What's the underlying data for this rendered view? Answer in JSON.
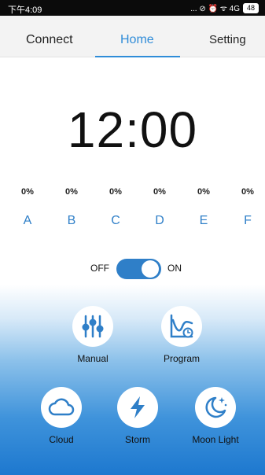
{
  "status_bar": {
    "time": "下午4:09",
    "icons": "... ⊘ ⏰ ᯤ 4G",
    "battery": "48"
  },
  "tabs": {
    "connect": "Connect",
    "home": "Home",
    "setting": "Setting",
    "active": "Home"
  },
  "clock": "12:00",
  "channels": [
    {
      "pct": "0%",
      "label": "A"
    },
    {
      "pct": "0%",
      "label": "B"
    },
    {
      "pct": "0%",
      "label": "C"
    },
    {
      "pct": "0%",
      "label": "D"
    },
    {
      "pct": "0%",
      "label": "E"
    },
    {
      "pct": "0%",
      "label": "F"
    }
  ],
  "power": {
    "off_label": "OFF",
    "on_label": "ON",
    "state": "on"
  },
  "modes": {
    "manual": "Manual",
    "program": "Program",
    "cloud": "Cloud",
    "storm": "Storm",
    "moon": "Moon Light"
  },
  "colors": {
    "accent": "#2f8cd8",
    "toggle_on": "#2f7fc8"
  }
}
